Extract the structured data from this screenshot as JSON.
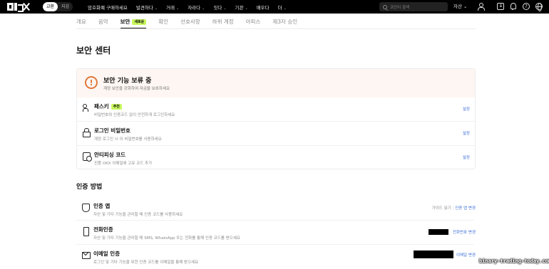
{
  "topnav": {
    "logo_alt": "OKX",
    "mode": [
      "교환",
      "지갑"
    ],
    "menu": [
      "암호화폐 구매하세요",
      "발견하다",
      "거래",
      "자라다",
      "짓다",
      "기관",
      "배우다",
      "더"
    ],
    "search_placeholder": "코인이 검색",
    "assets": "자산"
  },
  "tabs": {
    "items": [
      "개요",
      "음악",
      "보안",
      "확인",
      "선호사항",
      "하위 계정",
      "아피스",
      "제3자 승인"
    ],
    "active_index": 2,
    "new_badge": "새로운"
  },
  "page_title": "보안 센터",
  "warning": {
    "title": "보안 기능 보류 중",
    "subtitle": "계정 보안을 강화하여 자금을 보호하세요"
  },
  "security_rows": [
    {
      "title": "패스키",
      "badge": "추천",
      "subtitle": "비밀번호와 인증코드 없이 안전하게 로그인하세요",
      "action": "설정",
      "icon": "passkey-icon"
    },
    {
      "title": "로그인 비밀번호",
      "subtitle": "계정 로그인 시 이 비밀번호를 사용하세요",
      "action": "설정",
      "icon": "lock-icon"
    },
    {
      "title": "안티피싱 코드",
      "subtitle": "진품 OKX 이메일에 고유 코드 추가",
      "action": "설정",
      "icon": "anti-phishing-icon"
    }
  ],
  "auth_section_title": "인증 방법",
  "auth_rows": [
    {
      "title": "인증 앱",
      "subtitle": "자산 및 기타 기능을 관리할 때 인증 코드를 사용하세요",
      "link1": "가이드 읽기",
      "link2": "인증 앱 변경",
      "icon": "shield-icon"
    },
    {
      "title": "전화인증",
      "subtitle": "자산 및 기타 기능을 관리할 때 SMS, WhatsApp 또는 전화를 통해 인증 코드를 받으세요",
      "link2": "전화번호 변경",
      "icon": "phone-icon"
    },
    {
      "title": "이메일 인증",
      "subtitle": "로그인 및 기타 기능을 위한 인증 코드를 이메일을 통해 받으세요",
      "link2": "이메일 변경",
      "icon": "mail-icon"
    }
  ],
  "watermark": "binary-trading-today.com"
}
